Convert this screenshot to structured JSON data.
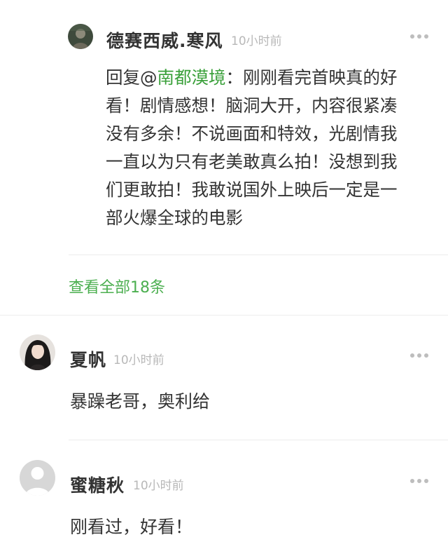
{
  "reply": {
    "author": "德赛西威.寒风",
    "time": "10小时前",
    "prefix": "回复@",
    "mention": "南都漠境",
    "lines": [
      "：刚刚看完首映真的好",
      "看！剧情感想！脑洞大开，内容很紧凑",
      "没有多余！不说画面和特效，光剧情我",
      "一直以为只有老美敢真么拍！没想到我",
      "们更敢拍！我敢说国外上映后一定是一",
      "部火爆全球的电影"
    ]
  },
  "view_all": "查看全部18条",
  "comments": [
    {
      "author": "夏帆",
      "time": "10小时前",
      "text": "暴躁老哥，奥利给"
    },
    {
      "author": "蜜糖秋",
      "time": "10小时前",
      "text": "刚看过，好看！"
    }
  ],
  "colors": {
    "mention": "#3aa03a",
    "view_all": "#4caf50",
    "time": "#b8b8b8",
    "text": "#333333"
  },
  "icons": {
    "more": "more-dots-icon",
    "default_avatar": "default-user-icon"
  }
}
